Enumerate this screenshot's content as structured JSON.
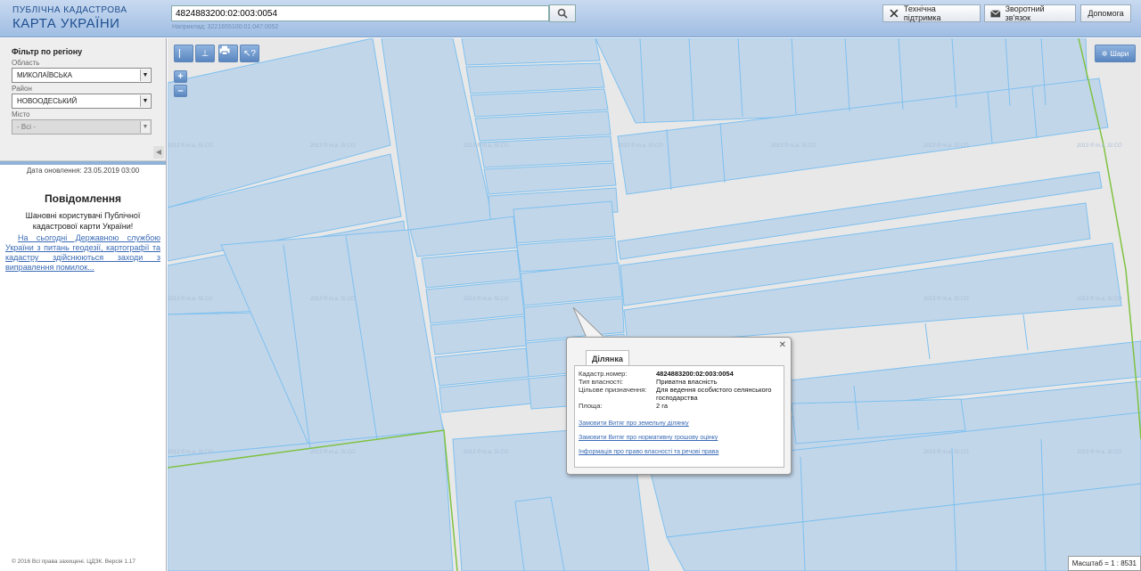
{
  "header": {
    "logo_line1": "ПУБЛІЧНА КАДАСТРОВА",
    "logo_line2": "КАРТА УКРАЇНИ",
    "search_value": "4824883200:02:003:0054",
    "search_hint": "Наприклад: 3221655100:01:047:0052",
    "support_label": "Технічна підтримка",
    "feedback_label": "Зворотний зв'язок",
    "help_label": "Допомога"
  },
  "sidebar": {
    "filter_title": "Фільтр по регіону",
    "oblast_label": "Область",
    "oblast_value": "МИКОЛАЇВСЬКА",
    "rayon_label": "Район",
    "rayon_value": "НОВООДЕСЬКИЙ",
    "city_label": "Місто",
    "city_value": "- Всі -",
    "updated": "Дата оновлення: 23.05.2019 03:00",
    "notice_title": "Повідомлення",
    "notice_text": "Шановні користувачі Публічної кадастрової карти України!",
    "notice_link": "На сьогодні Державною службою України з питань геодезії, картографії та кадастру здійснюються заходи з виправлення помилок...",
    "copyright": "© 2016 Всі права захищені. ЦДЗК. Версія 1.17"
  },
  "map": {
    "layers_label": "Шари",
    "watermark": "2013 ® т.в. SI.CO",
    "scale": "Масштаб = 1 : 8531"
  },
  "popup": {
    "tab": "Ділянка",
    "cadastre_label": "Кадастр.номер:",
    "cadastre_value": "4824883200:02:003:0054",
    "ownership_label": "Тип власності:",
    "ownership_value": "Приватна власність",
    "purpose_label": "Цільове призначення:",
    "purpose_value": "Для ведення особистого селянського господарства",
    "area_label": "Площа:",
    "area_value": "2 га",
    "link1": "Замовити Витяг про земельну ділянку",
    "link2": "Замовити Витяг про нормативну грошову оцінку",
    "link3": "Інформація про право власності та речові права"
  },
  "colors": {
    "parcel_fill": "#c2d6ea",
    "parcel_stroke": "#7ec0ee",
    "boundary": "#7fc241",
    "background": "#e8e8e8"
  }
}
